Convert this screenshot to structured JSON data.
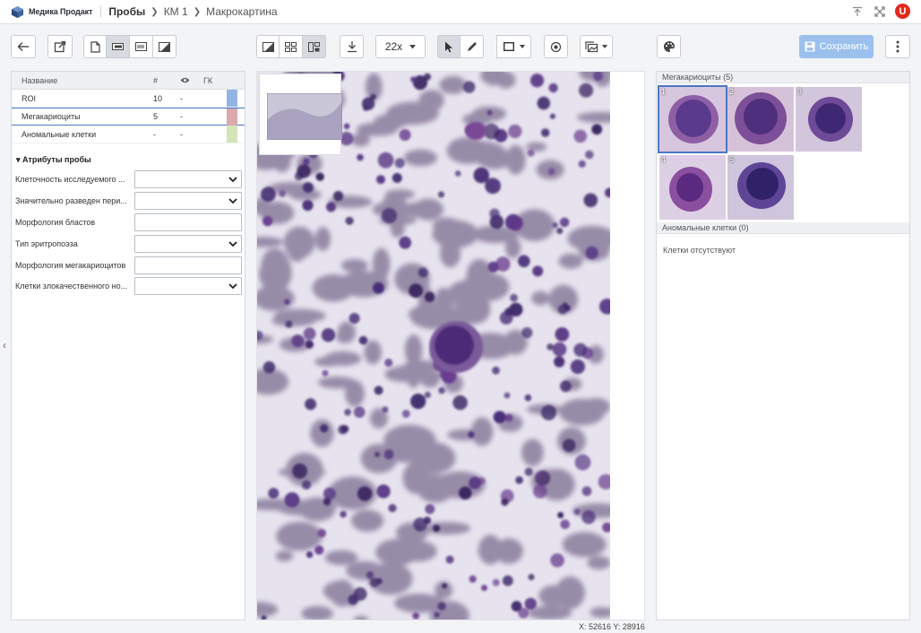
{
  "header": {
    "logo_text": "Медика Продакт",
    "breadcrumbs": [
      "Пробы",
      "КМ 1",
      "Макрокартина"
    ],
    "user_badge": "U"
  },
  "toolbar": {
    "zoom_value": "22x",
    "save_label": "Сохранить"
  },
  "annotations_table": {
    "headers": {
      "name": "Название",
      "count": "#",
      "visibility": "eye-icon",
      "gk": "ГК"
    },
    "rows": [
      {
        "name": "ROI",
        "count": "10",
        "visible": "-",
        "color": "#92b4e3"
      },
      {
        "name": "Мегакариоциты",
        "count": "5",
        "visible": "-",
        "color": "#d9a9ae"
      },
      {
        "name": "Аномальные клетки",
        "count": "-",
        "visible": "-",
        "color": "#d3e4b6"
      }
    ],
    "selected_row": 1
  },
  "attributes": {
    "title": "Атрибуты пробы",
    "fields": [
      {
        "label": "Клеточность исследуемого ...",
        "type": "select",
        "value": ""
      },
      {
        "label": "Значительно разведен пери...",
        "type": "select",
        "value": ""
      },
      {
        "label": "Морфология бластов",
        "type": "text",
        "value": ""
      },
      {
        "label": "Тип эритропоэза",
        "type": "select",
        "value": ""
      },
      {
        "label": "Морфология мегакариоцитов",
        "type": "text",
        "value": ""
      },
      {
        "label": "Клетки злокачественного но...",
        "type": "select",
        "value": ""
      }
    ]
  },
  "viewer": {
    "coords": "X: 52616  Y: 28916"
  },
  "right_panel": {
    "megakaryocytes_header": "Мегакариоциты (5)",
    "thumbnails": [
      "1",
      "2",
      "3",
      "4",
      "5"
    ],
    "selected_thumbnail": 0,
    "abnormal_header": "Аномальные клетки (0)",
    "abnormal_empty": "Клетки отсутствуют"
  },
  "colors": {
    "accent": "#4a78c2",
    "save_button": "#9bc0ee",
    "brand_badge": "#e02a1d"
  }
}
